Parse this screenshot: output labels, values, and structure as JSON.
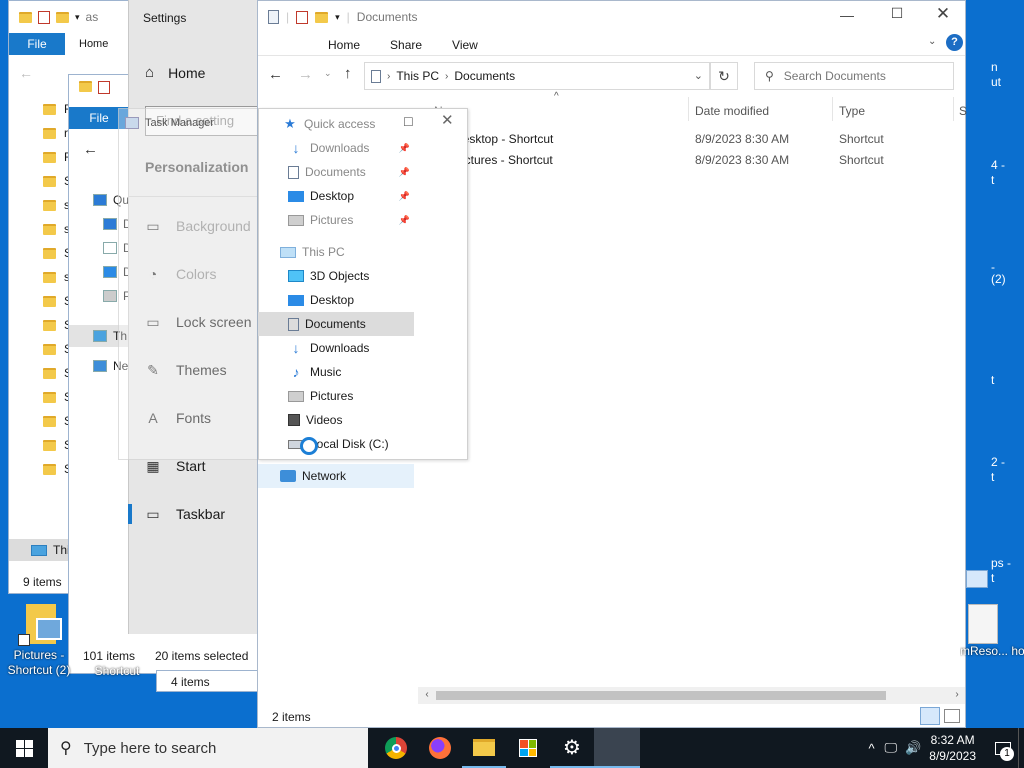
{
  "left_explorer": {
    "title_partial": "as",
    "ribbon_file": "File",
    "ribbon_home": "Home",
    "folder_items": [
      "R",
      "re",
      "R",
      "Sc",
      "sc",
      "se",
      "Sc",
      "se",
      "Sl",
      "Sl",
      "Sl",
      "Sc",
      "Sc",
      "Sp",
      "Sy",
      "Sy"
    ],
    "this_pc": "Thi",
    "status_items": "9 items"
  },
  "second_explorer": {
    "ribbon_file": "File",
    "nav_items": [
      {
        "label": "Qu",
        "icon": "star-icon"
      },
      {
        "label": "D",
        "icon": "download-icon"
      },
      {
        "label": "D",
        "icon": "document-icon"
      },
      {
        "label": "D",
        "icon": "desktop-icon"
      },
      {
        "label": "P",
        "icon": "pictures-icon"
      },
      {
        "label": "Th",
        "icon": "computer-icon"
      },
      {
        "label": "Ne",
        "icon": "network-icon"
      }
    ],
    "status_items": "101 items",
    "status_selected": "20 items selected",
    "status_third": "4 items"
  },
  "settings": {
    "title": "Settings",
    "home": "Home",
    "search_placeholder": "Find a setting",
    "section": "Personalization",
    "items": [
      {
        "label": "Background",
        "icon": "image-icon"
      },
      {
        "label": "Colors",
        "icon": "palette-icon"
      },
      {
        "label": "Lock screen",
        "icon": "lock-screen-icon"
      },
      {
        "label": "Themes",
        "icon": "themes-icon"
      },
      {
        "label": "Fonts",
        "icon": "fonts-icon"
      },
      {
        "label": "Start",
        "icon": "start-icon"
      },
      {
        "label": "Taskbar",
        "icon": "taskbar-icon"
      }
    ]
  },
  "task_manager_ghost": "Task Manager",
  "explorer": {
    "title": "Documents",
    "tabs": [
      "Home",
      "Share",
      "View"
    ],
    "breadcrumb": [
      "This PC",
      "Documents"
    ],
    "search_placeholder": "Search Documents",
    "columns": [
      "Name",
      "Date modified",
      "Type",
      "S"
    ],
    "files": [
      {
        "name": "Desktop - Shortcut",
        "date": "8/9/2023 8:30 AM",
        "type": "Shortcut"
      },
      {
        "name": "Pictures - Shortcut",
        "date": "8/9/2023 8:30 AM",
        "type": "Shortcut"
      }
    ],
    "quick_access": "Quick access",
    "qa_items": [
      "Downloads",
      "Documents",
      "Desktop",
      "Pictures"
    ],
    "this_pc": "This PC",
    "pc_items": [
      "3D Objects",
      "Desktop",
      "Documents",
      "Downloads",
      "Music",
      "Pictures",
      "Videos",
      "Local Disk (C:)"
    ],
    "network": "Network",
    "status": "2 items"
  },
  "desktop_icons": [
    {
      "label": "Pictures - Shortcut (2)"
    },
    {
      "label": "Shortcut"
    },
    {
      "label": "mReso... hortcut"
    }
  ],
  "right_edge_labels": [
    "n",
    "ut",
    "4 -",
    "t",
    "(2)",
    "-",
    "t",
    "2 -",
    "t",
    "ps -",
    "t"
  ],
  "taskbar": {
    "search_placeholder": "Type here to search",
    "time": "8:32 AM",
    "date": "8/9/2023",
    "notification_count": "1"
  }
}
